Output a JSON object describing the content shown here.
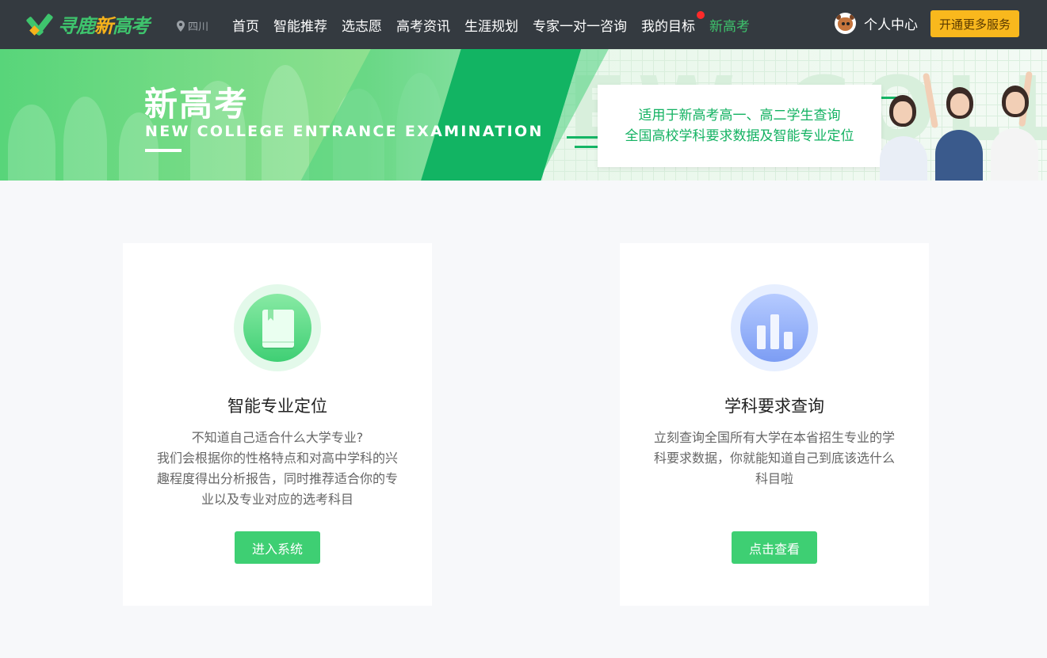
{
  "nav": {
    "logo": {
      "part1": "寻鹿",
      "part2": "新",
      "part3": "高考"
    },
    "location": "四川",
    "menu": [
      {
        "label": "首页",
        "active": false
      },
      {
        "label": "智能推荐",
        "active": false
      },
      {
        "label": "选志愿",
        "active": false
      },
      {
        "label": "高考资讯",
        "active": false
      },
      {
        "label": "生涯规划",
        "active": false
      },
      {
        "label": "专家一对一咨询",
        "active": false
      },
      {
        "label": "我的目标",
        "active": false,
        "badge_dot": true
      },
      {
        "label": "新高考",
        "active": true
      }
    ],
    "user_label": "个人中心",
    "vip_button": "开通更多服务"
  },
  "banner": {
    "title": "新高考",
    "subtitle": "NEW COLLEGE ENTRANCE EXAMINATION",
    "background_word": "NEW COLLEG",
    "card_lines": [
      "适用于新高考高一、高二学生查询",
      "全国高校学科要求数据及智能专业定位"
    ]
  },
  "cards": [
    {
      "icon": "book-icon",
      "title": "智能专业定位",
      "description": "不知道自己适合什么大学专业?\n我们会根据你的性格特点和对高中学科的兴趣程度得出分析报告，同时推荐适合你的专业以及专业对应的选考科目",
      "description_lines": [
        "不知道自己适合什么大学专业?",
        "我们会根据你的性格特点和对高中学科的兴",
        "趣程度得出分析报告，同时推荐适合你的专",
        "业以及专业对应的选考科目"
      ],
      "button": "进入系统"
    },
    {
      "icon": "bar-chart-icon",
      "title": "学科要求查询",
      "description_lines": [
        "立刻查询全国所有大学在本省招生专业的学",
        "科要求数据，你就能知道自己到底该选什么",
        "科目啦"
      ],
      "button": "点击查看"
    }
  ],
  "colors": {
    "nav_bg": "#343a40",
    "accent_green": "#3ecf73",
    "vip_yellow": "#f9b81d",
    "active_menu": "#3ec46d"
  }
}
